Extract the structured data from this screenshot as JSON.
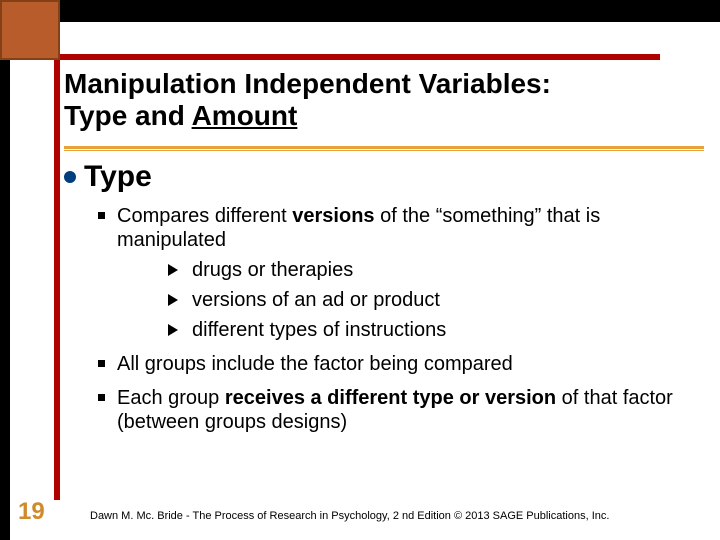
{
  "title": {
    "line1": "Manipulation Independent Variables:",
    "line2_plain": "Type and ",
    "line2_underlined": "Amount"
  },
  "heading": "Type",
  "bullets": {
    "b1_pre": "Compares different  ",
    "b1_strong": "versions",
    "b1_post": "  of the “something” that is manipulated",
    "sub1": "drugs or therapies",
    "sub2": "versions of an ad or product",
    "sub3": "different types of instructions",
    "b2": "All groups include the factor being compared",
    "b3_pre": "Each group ",
    "b3_strong": "receives a different type or version",
    "b3_post": " of that factor  (between groups designs)"
  },
  "page_number": "19",
  "footer": "Dawn M. Mc. Bride - The Process of Research in Psychology, 2 nd Edition © 2013 SAGE Publications, Inc."
}
